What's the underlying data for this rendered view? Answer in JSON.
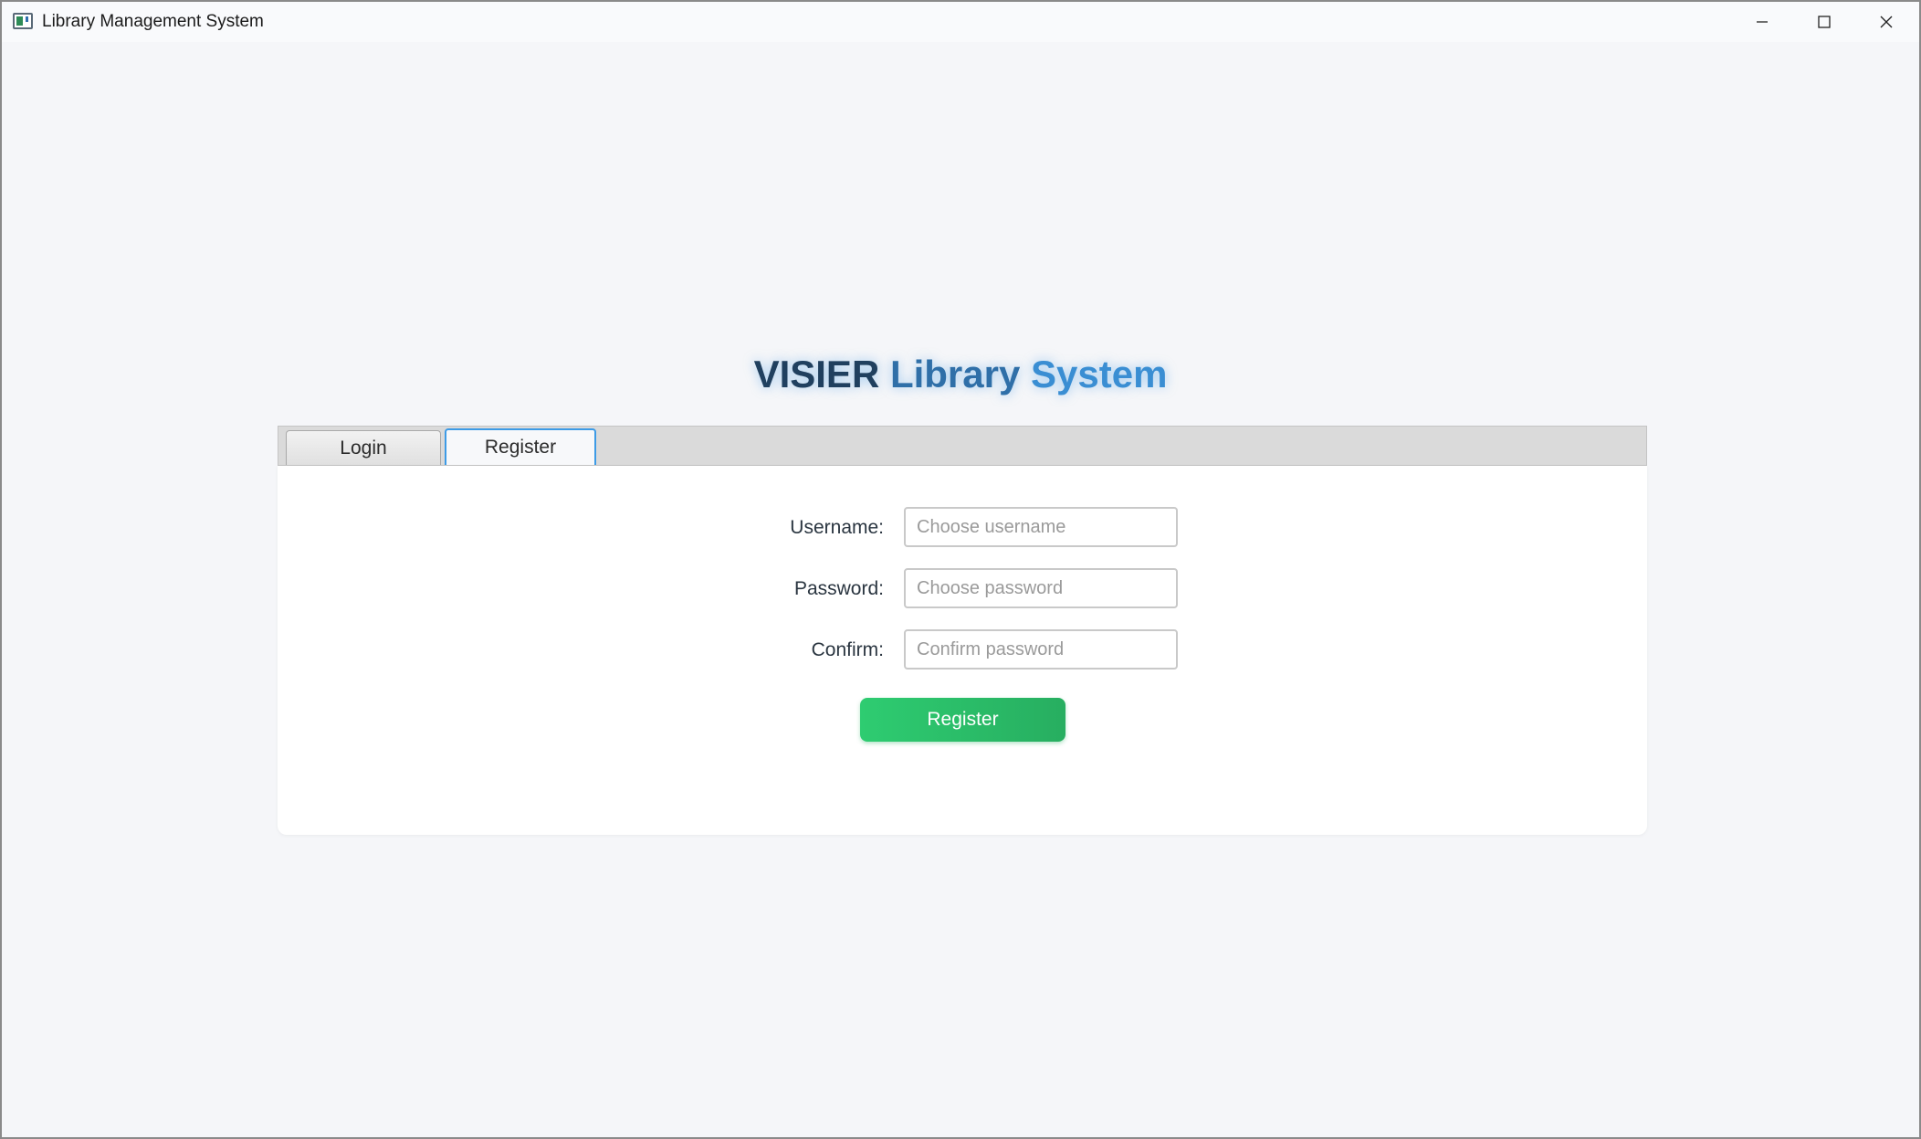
{
  "window": {
    "title": "Library Management System"
  },
  "heading": {
    "part1": "VISIER",
    "part2": "Library",
    "part3": "System"
  },
  "tabs": [
    {
      "label": "Login",
      "selected": false
    },
    {
      "label": "Register",
      "selected": true
    }
  ],
  "form": {
    "username_label": "Username:",
    "username_placeholder": "Choose username",
    "password_label": "Password:",
    "password_placeholder": "Choose password",
    "confirm_label": "Confirm:",
    "confirm_placeholder": "Confirm password",
    "submit_label": "Register"
  },
  "icons": {
    "app": "app-window-icon",
    "minimize": "minimize-icon",
    "maximize": "maximize-icon",
    "close": "close-icon"
  },
  "colors": {
    "accent_blue": "#3d9be6",
    "button_green": "#2ecc71",
    "heading_dark": "#20405f",
    "heading_blue": "#3a8ed3"
  }
}
